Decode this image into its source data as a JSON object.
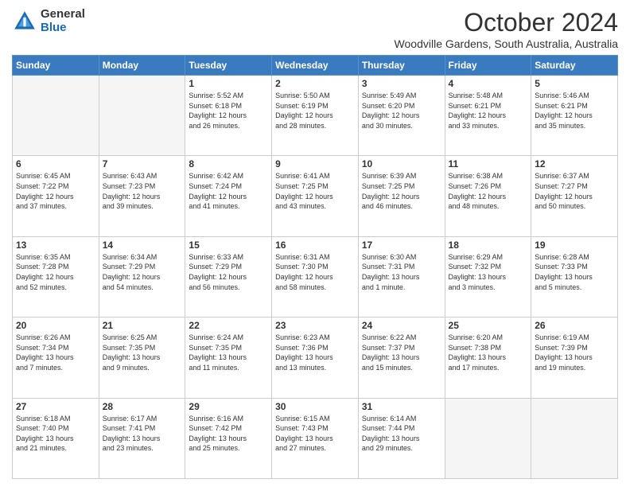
{
  "logo": {
    "general": "General",
    "blue": "Blue"
  },
  "header": {
    "month": "October 2024",
    "location": "Woodville Gardens, South Australia, Australia"
  },
  "weekdays": [
    "Sunday",
    "Monday",
    "Tuesday",
    "Wednesday",
    "Thursday",
    "Friday",
    "Saturday"
  ],
  "weeks": [
    [
      {
        "day": "",
        "info": ""
      },
      {
        "day": "",
        "info": ""
      },
      {
        "day": "1",
        "info": "Sunrise: 5:52 AM\nSunset: 6:18 PM\nDaylight: 12 hours\nand 26 minutes."
      },
      {
        "day": "2",
        "info": "Sunrise: 5:50 AM\nSunset: 6:19 PM\nDaylight: 12 hours\nand 28 minutes."
      },
      {
        "day": "3",
        "info": "Sunrise: 5:49 AM\nSunset: 6:20 PM\nDaylight: 12 hours\nand 30 minutes."
      },
      {
        "day": "4",
        "info": "Sunrise: 5:48 AM\nSunset: 6:21 PM\nDaylight: 12 hours\nand 33 minutes."
      },
      {
        "day": "5",
        "info": "Sunrise: 5:46 AM\nSunset: 6:21 PM\nDaylight: 12 hours\nand 35 minutes."
      }
    ],
    [
      {
        "day": "6",
        "info": "Sunrise: 6:45 AM\nSunset: 7:22 PM\nDaylight: 12 hours\nand 37 minutes."
      },
      {
        "day": "7",
        "info": "Sunrise: 6:43 AM\nSunset: 7:23 PM\nDaylight: 12 hours\nand 39 minutes."
      },
      {
        "day": "8",
        "info": "Sunrise: 6:42 AM\nSunset: 7:24 PM\nDaylight: 12 hours\nand 41 minutes."
      },
      {
        "day": "9",
        "info": "Sunrise: 6:41 AM\nSunset: 7:25 PM\nDaylight: 12 hours\nand 43 minutes."
      },
      {
        "day": "10",
        "info": "Sunrise: 6:39 AM\nSunset: 7:25 PM\nDaylight: 12 hours\nand 46 minutes."
      },
      {
        "day": "11",
        "info": "Sunrise: 6:38 AM\nSunset: 7:26 PM\nDaylight: 12 hours\nand 48 minutes."
      },
      {
        "day": "12",
        "info": "Sunrise: 6:37 AM\nSunset: 7:27 PM\nDaylight: 12 hours\nand 50 minutes."
      }
    ],
    [
      {
        "day": "13",
        "info": "Sunrise: 6:35 AM\nSunset: 7:28 PM\nDaylight: 12 hours\nand 52 minutes."
      },
      {
        "day": "14",
        "info": "Sunrise: 6:34 AM\nSunset: 7:29 PM\nDaylight: 12 hours\nand 54 minutes."
      },
      {
        "day": "15",
        "info": "Sunrise: 6:33 AM\nSunset: 7:29 PM\nDaylight: 12 hours\nand 56 minutes."
      },
      {
        "day": "16",
        "info": "Sunrise: 6:31 AM\nSunset: 7:30 PM\nDaylight: 12 hours\nand 58 minutes."
      },
      {
        "day": "17",
        "info": "Sunrise: 6:30 AM\nSunset: 7:31 PM\nDaylight: 13 hours\nand 1 minute."
      },
      {
        "day": "18",
        "info": "Sunrise: 6:29 AM\nSunset: 7:32 PM\nDaylight: 13 hours\nand 3 minutes."
      },
      {
        "day": "19",
        "info": "Sunrise: 6:28 AM\nSunset: 7:33 PM\nDaylight: 13 hours\nand 5 minutes."
      }
    ],
    [
      {
        "day": "20",
        "info": "Sunrise: 6:26 AM\nSunset: 7:34 PM\nDaylight: 13 hours\nand 7 minutes."
      },
      {
        "day": "21",
        "info": "Sunrise: 6:25 AM\nSunset: 7:35 PM\nDaylight: 13 hours\nand 9 minutes."
      },
      {
        "day": "22",
        "info": "Sunrise: 6:24 AM\nSunset: 7:35 PM\nDaylight: 13 hours\nand 11 minutes."
      },
      {
        "day": "23",
        "info": "Sunrise: 6:23 AM\nSunset: 7:36 PM\nDaylight: 13 hours\nand 13 minutes."
      },
      {
        "day": "24",
        "info": "Sunrise: 6:22 AM\nSunset: 7:37 PM\nDaylight: 13 hours\nand 15 minutes."
      },
      {
        "day": "25",
        "info": "Sunrise: 6:20 AM\nSunset: 7:38 PM\nDaylight: 13 hours\nand 17 minutes."
      },
      {
        "day": "26",
        "info": "Sunrise: 6:19 AM\nSunset: 7:39 PM\nDaylight: 13 hours\nand 19 minutes."
      }
    ],
    [
      {
        "day": "27",
        "info": "Sunrise: 6:18 AM\nSunset: 7:40 PM\nDaylight: 13 hours\nand 21 minutes."
      },
      {
        "day": "28",
        "info": "Sunrise: 6:17 AM\nSunset: 7:41 PM\nDaylight: 13 hours\nand 23 minutes."
      },
      {
        "day": "29",
        "info": "Sunrise: 6:16 AM\nSunset: 7:42 PM\nDaylight: 13 hours\nand 25 minutes."
      },
      {
        "day": "30",
        "info": "Sunrise: 6:15 AM\nSunset: 7:43 PM\nDaylight: 13 hours\nand 27 minutes."
      },
      {
        "day": "31",
        "info": "Sunrise: 6:14 AM\nSunset: 7:44 PM\nDaylight: 13 hours\nand 29 minutes."
      },
      {
        "day": "",
        "info": ""
      },
      {
        "day": "",
        "info": ""
      }
    ]
  ]
}
